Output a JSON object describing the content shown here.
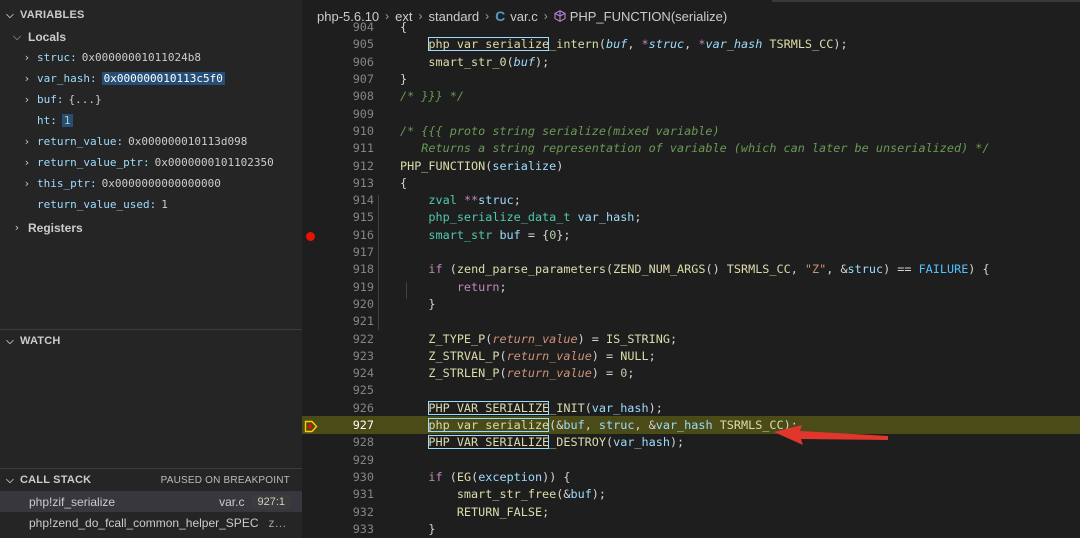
{
  "sidebar": {
    "variables": {
      "title": "VARIABLES",
      "locals_label": "Locals",
      "items": [
        {
          "name": "struc",
          "value": "0x00000001011024b8",
          "expandable": true
        },
        {
          "name": "var_hash",
          "value": "0x000000010113c5f0",
          "expandable": true
        },
        {
          "name": "buf",
          "value": "{...}",
          "expandable": true
        },
        {
          "name": "ht",
          "value": "1",
          "expandable": false
        },
        {
          "name": "return_value",
          "value": "0x000000010113d098",
          "expandable": true
        },
        {
          "name": "return_value_ptr",
          "value": "0x0000000101102350",
          "expandable": true
        },
        {
          "name": "this_ptr",
          "value": "0x0000000000000000",
          "expandable": true
        },
        {
          "name": "return_value_used",
          "value": "1",
          "expandable": false
        }
      ],
      "registers_label": "Registers"
    },
    "watch": {
      "title": "WATCH"
    },
    "call_stack": {
      "title": "CALL STACK",
      "status": "PAUSED ON BREAKPOINT",
      "frames": [
        {
          "function": "php!zif_serialize",
          "file": "var.c",
          "line": "927:1"
        },
        {
          "function": "php!zend_do_fcall_common_helper_SPEC",
          "file": "z…",
          "line": ""
        }
      ]
    }
  },
  "breadcrumb": {
    "parts": [
      "php-5.6.10",
      "ext",
      "standard"
    ],
    "file": "var.c",
    "symbol": "PHP_FUNCTION(serialize)"
  },
  "editor": {
    "current_line": "927",
    "breakpoint_line": "916",
    "colors": {
      "current_line_bg": "#4b4b18",
      "arrow": "#e0362b",
      "breakpoint": "#e51400"
    },
    "line_numbers": [
      "904",
      "905",
      "906",
      "907",
      "908",
      "909",
      "910",
      "911",
      "912",
      "913",
      "914",
      "915",
      "916",
      "917",
      "918",
      "919",
      "920",
      "921",
      "922",
      "923",
      "924",
      "925",
      "926",
      "927",
      "928",
      "929",
      "930",
      "931",
      "932",
      "933"
    ]
  }
}
